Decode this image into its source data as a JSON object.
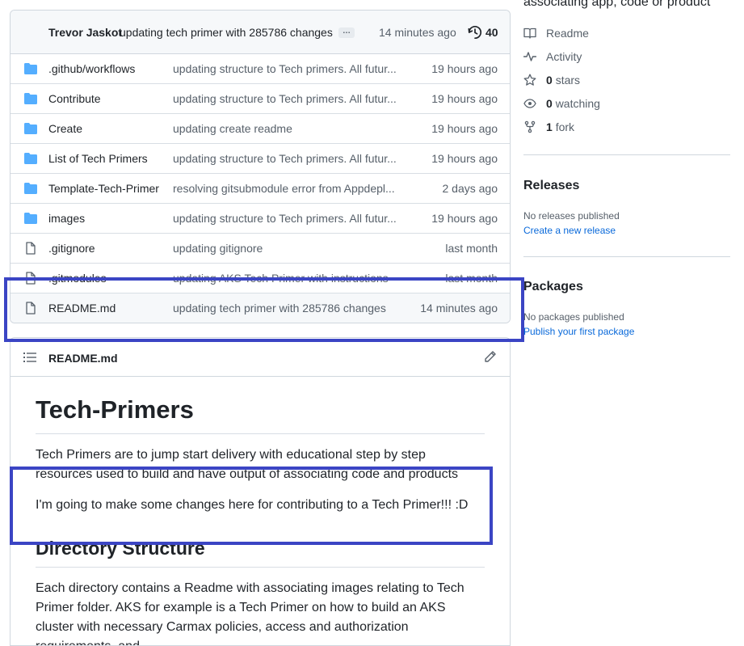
{
  "commit": {
    "author": "Trevor Jaskot",
    "message": "updating tech primer with 285786 changes",
    "ellipsis": "…",
    "time": "14 minutes ago",
    "history_count": "40"
  },
  "files": [
    {
      "name": ".github/workflows",
      "type": "folder",
      "message": "updating structure to Tech primers. All futur...",
      "time": "19 hours ago"
    },
    {
      "name": "Contribute",
      "type": "folder",
      "message": "updating structure to Tech primers. All futur...",
      "time": "19 hours ago"
    },
    {
      "name": "Create",
      "type": "folder",
      "message": "updating create readme",
      "time": "19 hours ago"
    },
    {
      "name": "List of Tech Primers",
      "type": "folder",
      "message": "updating structure to Tech primers. All futur...",
      "time": "19 hours ago"
    },
    {
      "name": "Template-Tech-Primer",
      "type": "folder",
      "message": "resolving gitsubmodule error from Appdepl...",
      "time": "2 days ago"
    },
    {
      "name": "images",
      "type": "folder",
      "message": "updating structure to Tech primers. All futur...",
      "time": "19 hours ago"
    },
    {
      "name": ".gitignore",
      "type": "file",
      "message": "updating gitignore",
      "time": "last month"
    },
    {
      "name": ".gitmodules",
      "type": "file",
      "message": "updating AKS Tech Primer with instructions",
      "time": "last month"
    },
    {
      "name": "README.md",
      "type": "file",
      "message": "updating tech primer with 285786 changes",
      "time": "14 minutes ago"
    }
  ],
  "readme": {
    "header_title": "README.md",
    "h1": "Tech-Primers",
    "p1": "Tech Primers are to jump start delivery with educational step by step resources used to build and have output of associating code and products",
    "p2": "I'm going to make some changes here for contributing to a Tech Primer!!! :D",
    "h2": "Directory Structure",
    "p3": "Each directory contains a Readme with associating images relating to Tech Primer folder. AKS for example is a Tech Primer on how to build an AKS cluster with necessary Carmax policies, access and authorization requirements, and"
  },
  "sidebar": {
    "about_desc": "associating app, code or product",
    "links": [
      {
        "icon": "book-icon",
        "label": "Readme",
        "count": ""
      },
      {
        "icon": "pulse-icon",
        "label": "Activity",
        "count": ""
      },
      {
        "icon": "star-icon",
        "label": "stars",
        "count": "0"
      },
      {
        "icon": "eye-icon",
        "label": "watching",
        "count": "0"
      },
      {
        "icon": "fork-icon",
        "label": "fork",
        "count": "1"
      }
    ],
    "releases": {
      "title": "Releases",
      "none": "No releases published",
      "create": "Create a new release"
    },
    "packages": {
      "title": "Packages",
      "none": "No packages published",
      "publish": "Publish your first package"
    }
  },
  "colors": {
    "folder": "#54aeff",
    "annotation": "#3b45c4",
    "link": "#0969da"
  }
}
